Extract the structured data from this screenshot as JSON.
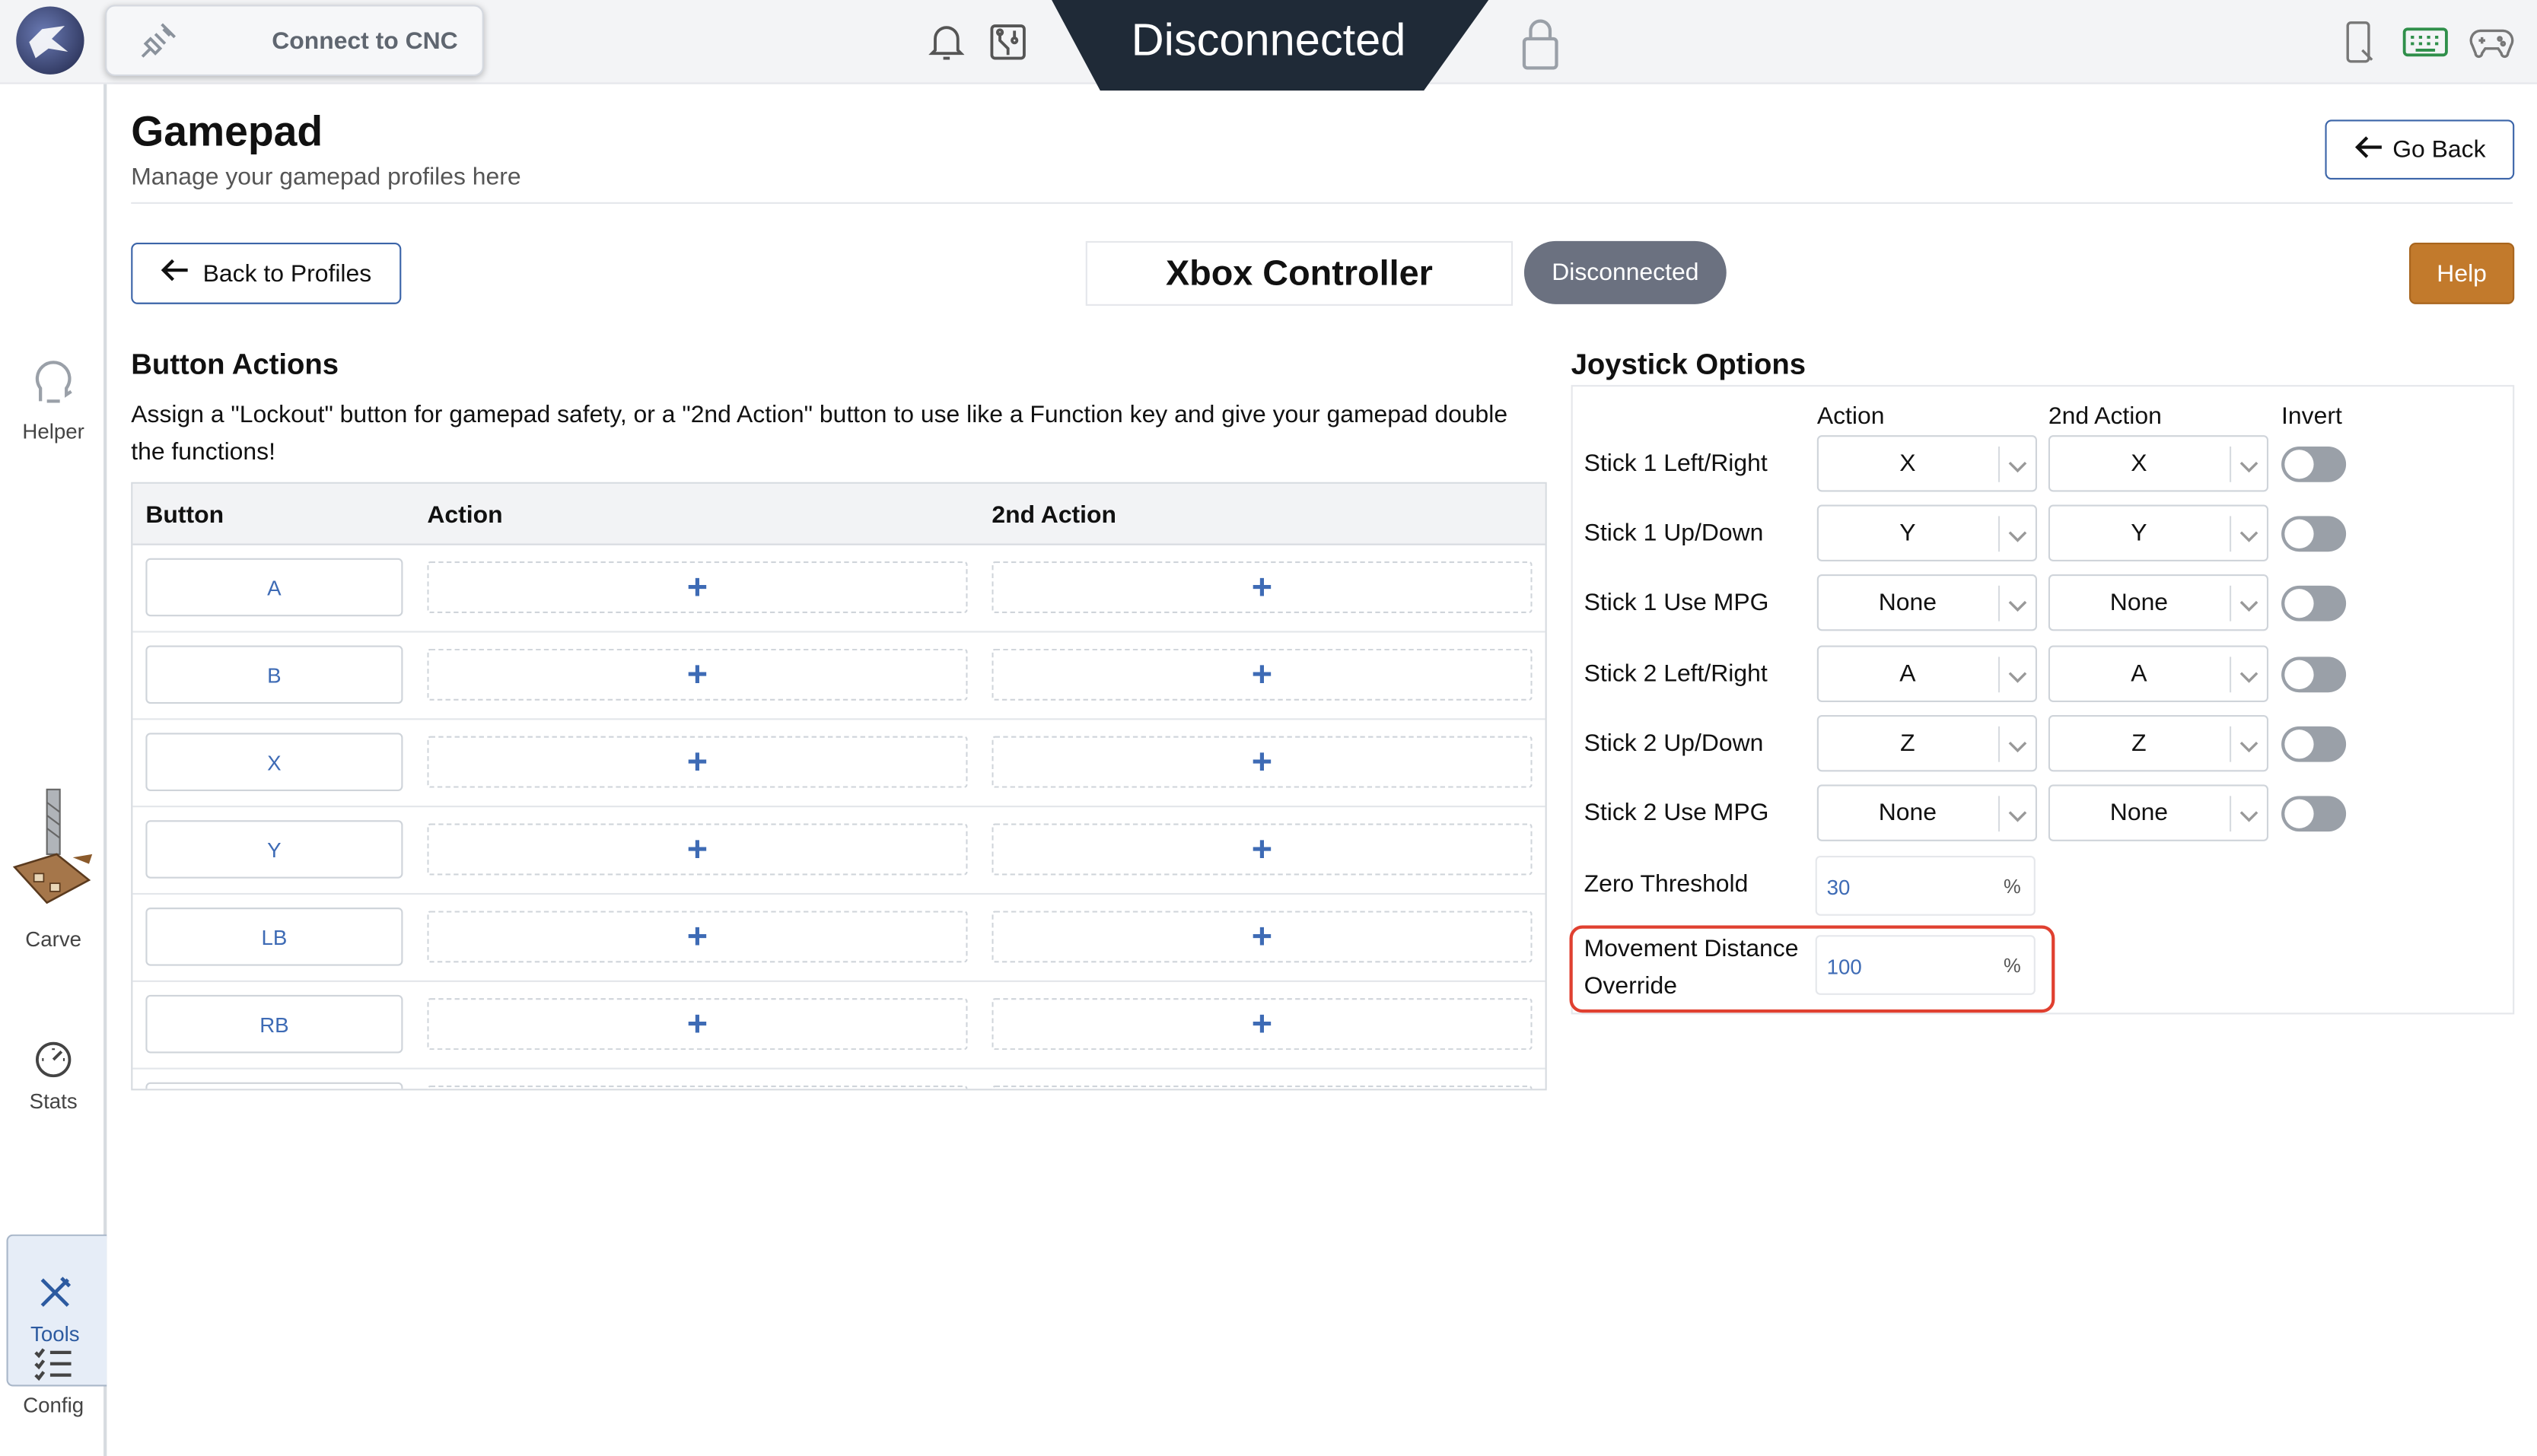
{
  "topbar": {
    "connect_label": "Connect to CNC",
    "status_text": "Disconnected",
    "icons": [
      "bell-icon",
      "circuit-icon",
      "lock-icon",
      "phone-icon",
      "keyboard-icon",
      "gamepad-icon"
    ],
    "banner_color": "#1f2a37"
  },
  "sidebar": {
    "helper": "Helper",
    "carve": "Carve",
    "stats": "Stats",
    "tools": "Tools",
    "config": "Config"
  },
  "page": {
    "title": "Gamepad",
    "subtitle": "Manage your gamepad profiles here",
    "go_back": "Go Back",
    "back_to_profiles": "Back to Profiles",
    "controller_name": "Xbox Controller",
    "connection_status": "Disconnected",
    "help": "Help"
  },
  "button_actions": {
    "title": "Button Actions",
    "description": "Assign a \"Lockout\" button for gamepad safety, or a \"2nd Action\" button to use like a Function key and give your gamepad double the functions!",
    "columns": [
      "Button",
      "Action",
      "2nd Action"
    ],
    "rows": [
      "A",
      "B",
      "X",
      "Y",
      "LB",
      "RB"
    ],
    "add_symbol": "+"
  },
  "joystick": {
    "title": "Joystick Options",
    "columns": {
      "action": "Action",
      "second_action": "2nd Action",
      "invert": "Invert"
    },
    "rows": [
      {
        "label": "Stick 1 Left/Right",
        "action": "X",
        "second": "X",
        "invert": false
      },
      {
        "label": "Stick 1 Up/Down",
        "action": "Y",
        "second": "Y",
        "invert": false
      },
      {
        "label": "Stick 1 Use MPG",
        "action": "None",
        "second": "None",
        "invert": false
      },
      {
        "label": "Stick 2 Left/Right",
        "action": "A",
        "second": "A",
        "invert": false
      },
      {
        "label": "Stick 2 Up/Down",
        "action": "Z",
        "second": "Z",
        "invert": false
      },
      {
        "label": "Stick 2 Use MPG",
        "action": "None",
        "second": "None",
        "invert": false
      }
    ],
    "zero_threshold": {
      "label": "Zero Threshold",
      "value": "30",
      "unit": "%"
    },
    "movement_override": {
      "label_line1": "Movement Distance",
      "label_line2": "Override",
      "value": "100",
      "unit": "%"
    }
  },
  "colors": {
    "accent_blue": "#3e6bb5",
    "help_orange": "#c27a2c",
    "badge_gray": "#6b7180",
    "highlight_red": "#e04030"
  }
}
